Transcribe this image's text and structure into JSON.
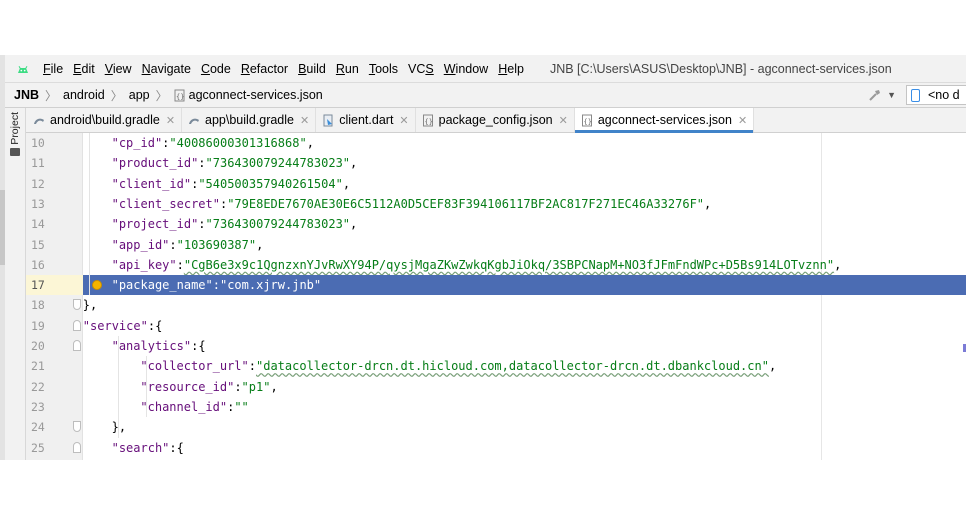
{
  "menubar": {
    "items": [
      {
        "label": "File",
        "mnemonic": "F",
        "rest": "ile"
      },
      {
        "label": "Edit",
        "mnemonic": "E",
        "rest": "dit"
      },
      {
        "label": "View",
        "mnemonic": "V",
        "rest": "iew"
      },
      {
        "label": "Navigate",
        "mnemonic": "N",
        "rest": "avigate"
      },
      {
        "label": "Code",
        "mnemonic": "C",
        "rest": "ode"
      },
      {
        "label": "Refactor",
        "mnemonic": "R",
        "rest": "efactor"
      },
      {
        "label": "Build",
        "mnemonic": "B",
        "rest": "uild"
      },
      {
        "label": "Run",
        "mnemonic": "R",
        "rest": "un",
        "pre": ""
      },
      {
        "label": "Tools",
        "mnemonic": "T",
        "rest": "ools"
      },
      {
        "label": "VCS",
        "mnemonic": "S",
        "pre": "VC",
        "rest": ""
      },
      {
        "label": "Window",
        "mnemonic": "W",
        "rest": "indow"
      },
      {
        "label": "Help",
        "mnemonic": "H",
        "rest": "elp"
      }
    ],
    "window_title": "JNB [C:\\Users\\ASUS\\Desktop\\JNB] - agconnect-services.json"
  },
  "navbar": {
    "crumbs": [
      "JNB",
      "android",
      "app",
      "agconnect-services.json"
    ],
    "device_label": "<no d"
  },
  "project_stripe": {
    "label": "Project"
  },
  "tabs": [
    {
      "label": "android\\build.gradle",
      "icon": "gradle-icon",
      "active": false
    },
    {
      "label": "app\\build.gradle",
      "icon": "gradle-icon",
      "active": false
    },
    {
      "label": "client.dart",
      "icon": "dart-file-icon",
      "active": false
    },
    {
      "label": "package_config.json",
      "icon": "json-file-icon",
      "active": false
    },
    {
      "label": "agconnect-services.json",
      "icon": "json-file-icon",
      "active": true
    }
  ],
  "editor": {
    "lines": [
      {
        "num": "10",
        "indent": 2,
        "key": "\"cp_id\"",
        "value": "\"40086000301316868\"",
        "tail": ","
      },
      {
        "num": "11",
        "indent": 2,
        "key": "\"product_id\"",
        "value": "\"736430079244783023\"",
        "tail": ","
      },
      {
        "num": "12",
        "indent": 2,
        "key": "\"client_id\"",
        "value": "\"540500357940261504\"",
        "tail": ","
      },
      {
        "num": "13",
        "indent": 2,
        "key": "\"client_secret\"",
        "value": "\"79E8EDE7670AE30E6C5112A0D5CEF83F394106117BF2AC817F271EC46A33276F\"",
        "tail": ","
      },
      {
        "num": "14",
        "indent": 2,
        "key": "\"project_id\"",
        "value": "\"736430079244783023\"",
        "tail": ","
      },
      {
        "num": "15",
        "indent": 2,
        "key": "\"app_id\"",
        "value": "\"103690387\"",
        "tail": ","
      },
      {
        "num": "16",
        "indent": 2,
        "key": "\"api_key\"",
        "value": "\"CgB6e3x9c1QgnzxnYJvRwXY94P/qysjMgaZKwZwkqKgbJiOkq/3SBPCNapM+NO3fJFmFndWPc+D5Bs914LOTvznn\"",
        "tail": ","
      },
      {
        "num": "17",
        "indent": 2,
        "key": "\"package_name\"",
        "value": "\"com.xjrw.jnb\"",
        "tail": ""
      },
      {
        "num": "18",
        "indent": 1,
        "key": "",
        "value": "",
        "tail": "},"
      },
      {
        "num": "19",
        "indent": 1,
        "key": "\"service\"",
        "value": "",
        "tail": "{"
      },
      {
        "num": "20",
        "indent": 2,
        "key": "\"analytics\"",
        "value": "",
        "tail": "{"
      },
      {
        "num": "21",
        "indent": 3,
        "key": "\"collector_url\"",
        "value": "\"datacollector-drcn.dt.hicloud.com,datacollector-drcn.dt.dbankcloud.cn\"",
        "tail": ","
      },
      {
        "num": "22",
        "indent": 3,
        "key": "\"resource_id\"",
        "value": "\"p1\"",
        "tail": ","
      },
      {
        "num": "23",
        "indent": 3,
        "key": "\"channel_id\"",
        "value": "\"\"",
        "tail": ""
      },
      {
        "num": "24",
        "indent": 2,
        "key": "",
        "value": "",
        "tail": "},"
      },
      {
        "num": "25",
        "indent": 2,
        "key": "\"search\"",
        "value": "",
        "tail": "{"
      }
    ],
    "highlighted_line": "17",
    "colors": {
      "key": "#660e7a",
      "string": "#067d17",
      "selection": "#4b6cb3"
    }
  }
}
